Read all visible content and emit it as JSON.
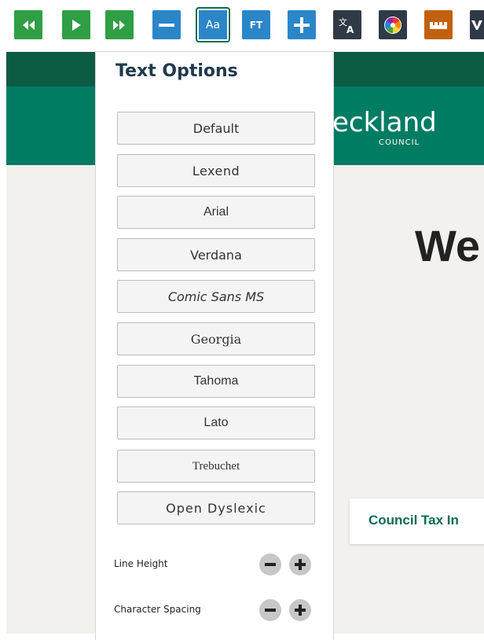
{
  "toolbar": {
    "buttons": [
      {
        "name": "rewind-button",
        "icon": "rewind-icon",
        "color": "#2f9e44"
      },
      {
        "name": "play-button",
        "icon": "play-icon",
        "color": "#2f9e44"
      },
      {
        "name": "fast-forward-button",
        "icon": "fast-forward-icon",
        "color": "#2f9e44"
      },
      {
        "name": "decrease-text-button",
        "icon": "minus-icon",
        "color": "#2b86c8"
      },
      {
        "name": "text-options-button",
        "icon": "text-options-icon",
        "label": "Aa",
        "color": "#2b86c8",
        "active": true
      },
      {
        "name": "font-type-button",
        "icon": "font-type-icon",
        "label": "FT",
        "color": "#2b86c8"
      },
      {
        "name": "increase-text-button",
        "icon": "plus-icon",
        "color": "#2b86c8"
      },
      {
        "name": "translate-button",
        "icon": "translate-icon",
        "color": "#2f3a46"
      },
      {
        "name": "color-button",
        "icon": "color-wheel-icon",
        "color": "#2f3a46"
      },
      {
        "name": "ruler-button",
        "icon": "ruler-icon",
        "color": "#c2600f"
      },
      {
        "name": "partial-button",
        "icon": "v-icon",
        "color": "#2f3a46"
      }
    ],
    "aa_label": "Aa",
    "ft_label": "FT"
  },
  "site": {
    "logo_text": "eckland",
    "logo_sub": "COUNCIL",
    "welcome_text": "We",
    "council_link": "Council Tax In",
    "colors": {
      "top_bar": "#0c5b45",
      "header": "#007c63",
      "body": "#f2f1ee"
    }
  },
  "panel": {
    "title": "Text Options",
    "fonts": [
      "Default",
      "Lexend",
      "Arial",
      "Verdana",
      "Comic Sans MS",
      "Georgia",
      "Tahoma",
      "Lato",
      "Trebuchet",
      "Open Dyslexic"
    ],
    "line_height_label": "Line Height",
    "character_spacing_label": "Character Spacing"
  }
}
